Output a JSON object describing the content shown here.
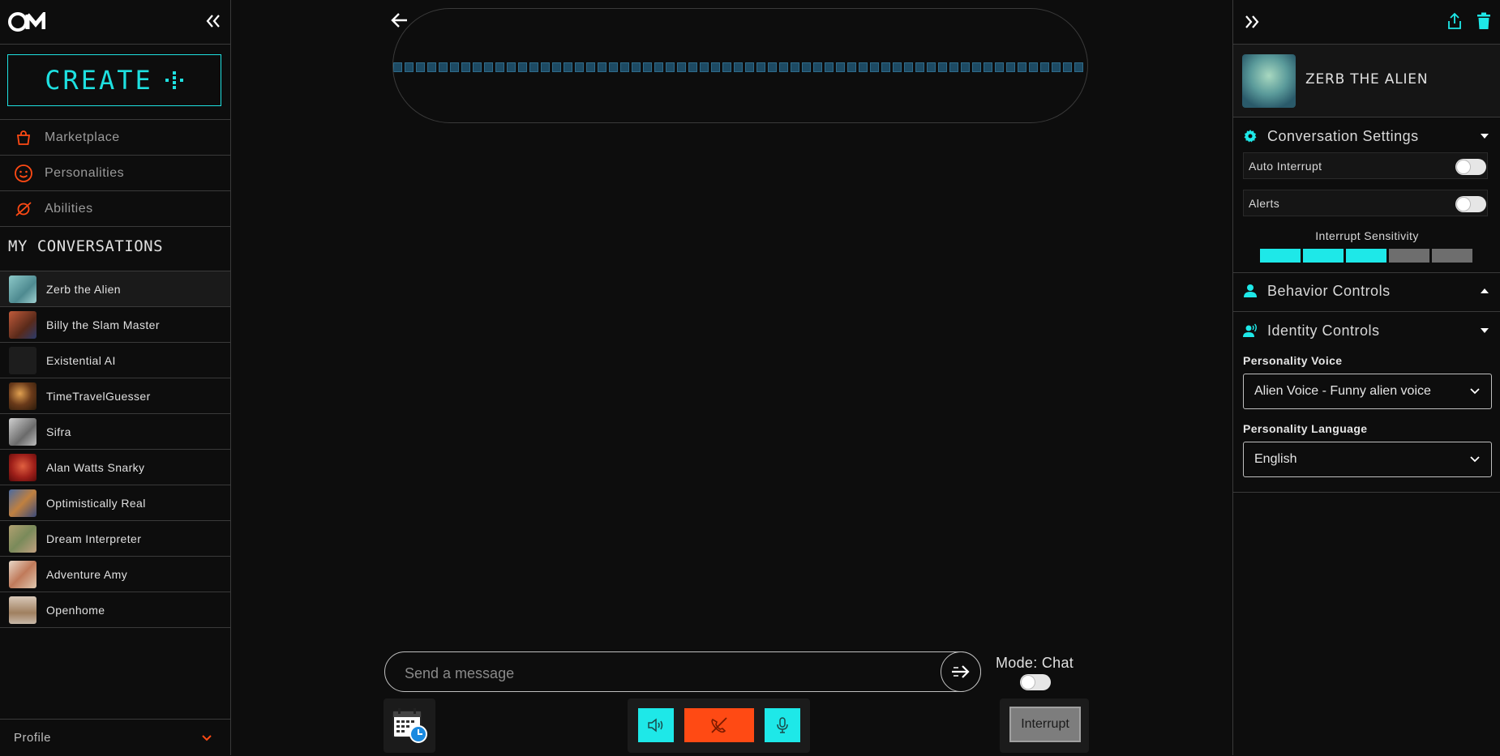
{
  "left_sidebar": {
    "create_label": "CREATE",
    "nav": [
      {
        "label": "Marketplace",
        "icon": "shopping-bag-icon"
      },
      {
        "label": "Personalities",
        "icon": "smiley-icon"
      },
      {
        "label": "Abilities",
        "icon": "orbit-icon"
      }
    ],
    "my_conversations_title": "MY CONVERSATIONS",
    "conversations": [
      {
        "name": "Zerb the Alien",
        "active": true,
        "color": "#6aa9b0"
      },
      {
        "name": "Billy the Slam Master",
        "color": "#8a4a3a"
      },
      {
        "name": "Existential AI",
        "color": "#222222"
      },
      {
        "name": "TimeTravelGuesser",
        "color": "#7a4a2a"
      },
      {
        "name": "Sifra",
        "color": "#9a9a9a"
      },
      {
        "name": "Alan Watts Snarky",
        "color": "#a02a1a"
      },
      {
        "name": "Optimistically Real",
        "color": "#6a7a9a"
      },
      {
        "name": "Dream Interpreter",
        "color": "#8a8a5a"
      },
      {
        "name": "Adventure Amy",
        "color": "#c8a890"
      },
      {
        "name": "Openhome",
        "color": "#b0a090"
      }
    ],
    "profile_label": "Profile"
  },
  "main": {
    "message_placeholder": "Send a message",
    "mode_label": "Mode: Chat",
    "interrupt_label": "Interrupt",
    "accent_color": "#1ee8e8",
    "danger_color": "#ff4a14"
  },
  "right_sidebar": {
    "persona_name": "ZERB THE ALIEN",
    "conversation_settings_title": "Conversation Settings",
    "auto_interrupt_label": "Auto Interrupt",
    "alerts_label": "Alerts",
    "interrupt_sensitivity_label": "Interrupt Sensitivity",
    "interrupt_sensitivity_level": 3,
    "interrupt_sensitivity_max": 5,
    "behavior_controls_title": "Behavior Controls",
    "identity_controls_title": "Identity Controls",
    "personality_voice_label": "Personality Voice",
    "personality_voice_value": "Alien Voice - Funny alien voice",
    "personality_language_label": "Personality Language",
    "personality_language_value": "English"
  }
}
